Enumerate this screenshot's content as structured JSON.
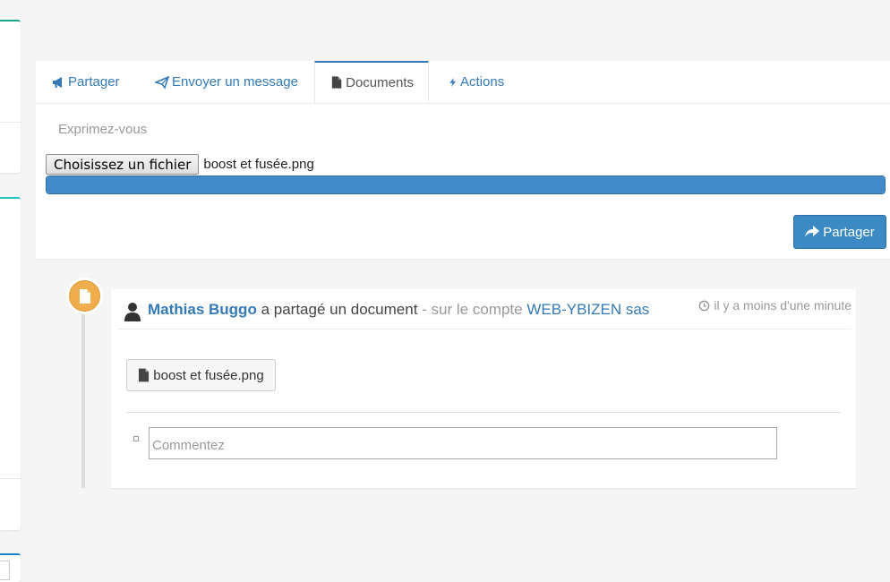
{
  "tabs": [
    {
      "label": "Partager",
      "icon": "bullhorn-icon"
    },
    {
      "label": "Envoyer un message",
      "icon": "paper-plane-icon"
    },
    {
      "label": "Documents",
      "icon": "file-icon",
      "active": true
    },
    {
      "label": "Actions",
      "icon": "bolt-icon"
    }
  ],
  "composer": {
    "placeholder": "Exprimez-vous",
    "file_button_label": "Choisissez un fichier",
    "file_name": "boost et fusée.png",
    "progress_fraction": 1.0,
    "share_label": "Partager"
  },
  "post": {
    "author": "Mathias Buggo",
    "verb": "a partagé un document",
    "account_prefix": "- sur le compte",
    "account": "WEB-YBIZEN sas",
    "time": "il y a moins d'une minute",
    "document_label": "boost et fusée.png",
    "comment_placeholder": "Commentez"
  },
  "colors": {
    "link": "#337ab7",
    "accent_orange": "#f0ad4e",
    "button_primary": "#3b8ac3",
    "progress": "#428bca"
  }
}
